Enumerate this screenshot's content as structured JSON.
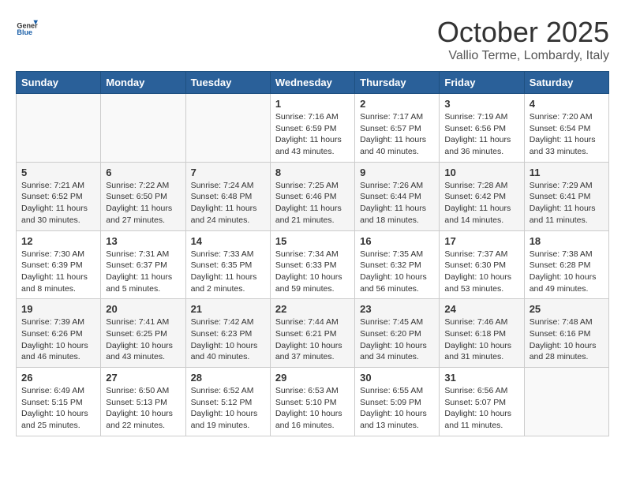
{
  "header": {
    "logo_general": "General",
    "logo_blue": "Blue",
    "month_title": "October 2025",
    "location": "Vallio Terme, Lombardy, Italy"
  },
  "days_of_week": [
    "Sunday",
    "Monday",
    "Tuesday",
    "Wednesday",
    "Thursday",
    "Friday",
    "Saturday"
  ],
  "weeks": [
    [
      {
        "day": "",
        "info": ""
      },
      {
        "day": "",
        "info": ""
      },
      {
        "day": "",
        "info": ""
      },
      {
        "day": "1",
        "info": "Sunrise: 7:16 AM\nSunset: 6:59 PM\nDaylight: 11 hours\nand 43 minutes."
      },
      {
        "day": "2",
        "info": "Sunrise: 7:17 AM\nSunset: 6:57 PM\nDaylight: 11 hours\nand 40 minutes."
      },
      {
        "day": "3",
        "info": "Sunrise: 7:19 AM\nSunset: 6:56 PM\nDaylight: 11 hours\nand 36 minutes."
      },
      {
        "day": "4",
        "info": "Sunrise: 7:20 AM\nSunset: 6:54 PM\nDaylight: 11 hours\nand 33 minutes."
      }
    ],
    [
      {
        "day": "5",
        "info": "Sunrise: 7:21 AM\nSunset: 6:52 PM\nDaylight: 11 hours\nand 30 minutes."
      },
      {
        "day": "6",
        "info": "Sunrise: 7:22 AM\nSunset: 6:50 PM\nDaylight: 11 hours\nand 27 minutes."
      },
      {
        "day": "7",
        "info": "Sunrise: 7:24 AM\nSunset: 6:48 PM\nDaylight: 11 hours\nand 24 minutes."
      },
      {
        "day": "8",
        "info": "Sunrise: 7:25 AM\nSunset: 6:46 PM\nDaylight: 11 hours\nand 21 minutes."
      },
      {
        "day": "9",
        "info": "Sunrise: 7:26 AM\nSunset: 6:44 PM\nDaylight: 11 hours\nand 18 minutes."
      },
      {
        "day": "10",
        "info": "Sunrise: 7:28 AM\nSunset: 6:42 PM\nDaylight: 11 hours\nand 14 minutes."
      },
      {
        "day": "11",
        "info": "Sunrise: 7:29 AM\nSunset: 6:41 PM\nDaylight: 11 hours\nand 11 minutes."
      }
    ],
    [
      {
        "day": "12",
        "info": "Sunrise: 7:30 AM\nSunset: 6:39 PM\nDaylight: 11 hours\nand 8 minutes."
      },
      {
        "day": "13",
        "info": "Sunrise: 7:31 AM\nSunset: 6:37 PM\nDaylight: 11 hours\nand 5 minutes."
      },
      {
        "day": "14",
        "info": "Sunrise: 7:33 AM\nSunset: 6:35 PM\nDaylight: 11 hours\nand 2 minutes."
      },
      {
        "day": "15",
        "info": "Sunrise: 7:34 AM\nSunset: 6:33 PM\nDaylight: 10 hours\nand 59 minutes."
      },
      {
        "day": "16",
        "info": "Sunrise: 7:35 AM\nSunset: 6:32 PM\nDaylight: 10 hours\nand 56 minutes."
      },
      {
        "day": "17",
        "info": "Sunrise: 7:37 AM\nSunset: 6:30 PM\nDaylight: 10 hours\nand 53 minutes."
      },
      {
        "day": "18",
        "info": "Sunrise: 7:38 AM\nSunset: 6:28 PM\nDaylight: 10 hours\nand 49 minutes."
      }
    ],
    [
      {
        "day": "19",
        "info": "Sunrise: 7:39 AM\nSunset: 6:26 PM\nDaylight: 10 hours\nand 46 minutes."
      },
      {
        "day": "20",
        "info": "Sunrise: 7:41 AM\nSunset: 6:25 PM\nDaylight: 10 hours\nand 43 minutes."
      },
      {
        "day": "21",
        "info": "Sunrise: 7:42 AM\nSunset: 6:23 PM\nDaylight: 10 hours\nand 40 minutes."
      },
      {
        "day": "22",
        "info": "Sunrise: 7:44 AM\nSunset: 6:21 PM\nDaylight: 10 hours\nand 37 minutes."
      },
      {
        "day": "23",
        "info": "Sunrise: 7:45 AM\nSunset: 6:20 PM\nDaylight: 10 hours\nand 34 minutes."
      },
      {
        "day": "24",
        "info": "Sunrise: 7:46 AM\nSunset: 6:18 PM\nDaylight: 10 hours\nand 31 minutes."
      },
      {
        "day": "25",
        "info": "Sunrise: 7:48 AM\nSunset: 6:16 PM\nDaylight: 10 hours\nand 28 minutes."
      }
    ],
    [
      {
        "day": "26",
        "info": "Sunrise: 6:49 AM\nSunset: 5:15 PM\nDaylight: 10 hours\nand 25 minutes."
      },
      {
        "day": "27",
        "info": "Sunrise: 6:50 AM\nSunset: 5:13 PM\nDaylight: 10 hours\nand 22 minutes."
      },
      {
        "day": "28",
        "info": "Sunrise: 6:52 AM\nSunset: 5:12 PM\nDaylight: 10 hours\nand 19 minutes."
      },
      {
        "day": "29",
        "info": "Sunrise: 6:53 AM\nSunset: 5:10 PM\nDaylight: 10 hours\nand 16 minutes."
      },
      {
        "day": "30",
        "info": "Sunrise: 6:55 AM\nSunset: 5:09 PM\nDaylight: 10 hours\nand 13 minutes."
      },
      {
        "day": "31",
        "info": "Sunrise: 6:56 AM\nSunset: 5:07 PM\nDaylight: 10 hours\nand 11 minutes."
      },
      {
        "day": "",
        "info": ""
      }
    ]
  ]
}
